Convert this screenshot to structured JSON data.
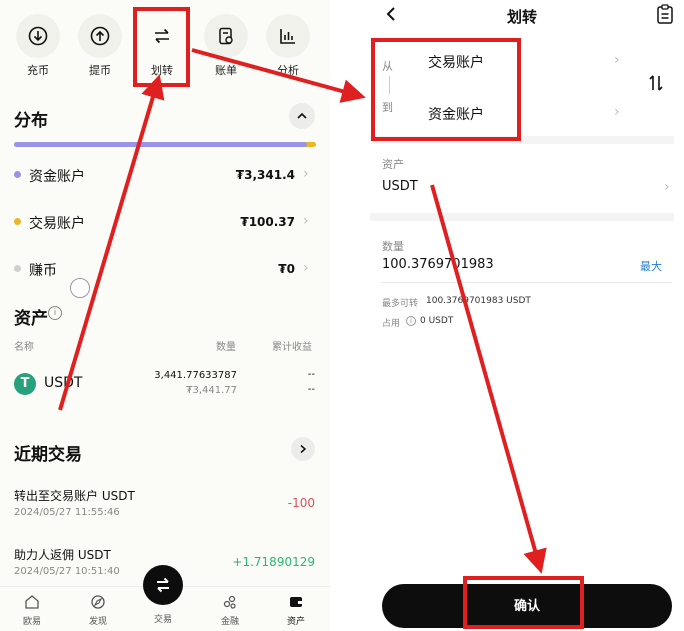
{
  "left": {
    "quick_actions": [
      {
        "label": "充币",
        "icon": "deposit-icon"
      },
      {
        "label": "提币",
        "icon": "withdraw-icon"
      },
      {
        "label": "划转",
        "icon": "transfer-icon"
      },
      {
        "label": "账单",
        "icon": "bill-icon"
      },
      {
        "label": "分析",
        "icon": "analysis-icon"
      }
    ],
    "distribution": {
      "title": "分布",
      "bar_fraction": 0.97,
      "accounts": [
        {
          "label": "资金账户",
          "value": "₮3,341.4",
          "color": "#9b93e6"
        },
        {
          "label": "交易账户",
          "value": "₮100.37",
          "color": "#e8b82a"
        },
        {
          "label": "赚币",
          "value": "₮0",
          "color": "#cfcfcf"
        }
      ]
    },
    "assets": {
      "title": "资产",
      "col_name": "名称",
      "col_qty": "数量",
      "col_pnl": "累计收益",
      "item": {
        "symbol": "USDT",
        "qty": "3,441.77633787",
        "value": "₮3,441.77",
        "pnl1": "--",
        "pnl2": "--"
      }
    },
    "recent": {
      "title": "近期交易",
      "items": [
        {
          "title": "转出至交易账户 USDT",
          "time": "2024/05/27 11:55:46",
          "amount": "-100",
          "color": "#d8525d"
        },
        {
          "title": "助力人返佣 USDT",
          "time": "2024/05/27 10:51:40",
          "amount": "+1.71890129",
          "color": "#2bb673"
        }
      ]
    },
    "bottom_nav": [
      "欧易",
      "发现",
      "交易",
      "金融",
      "资产"
    ]
  },
  "right": {
    "title": "划转",
    "from_label": "从",
    "from_value": "交易账户",
    "to_label": "到",
    "to_value": "资金账户",
    "asset_label": "资产",
    "asset_value": "USDT",
    "qty_label": "数量",
    "qty_value": "100.3769701983",
    "max_label": "最大",
    "max_transfer_label": "最多可转",
    "max_transfer_value": "100.3769701983 USDT",
    "occupied_label": "占用",
    "occupied_value": "0 USDT",
    "confirm_label": "确认"
  },
  "colors": {
    "accent_red": "#e02020",
    "link_blue": "#1f7fd6",
    "purple_bar": "#9b93e6"
  }
}
